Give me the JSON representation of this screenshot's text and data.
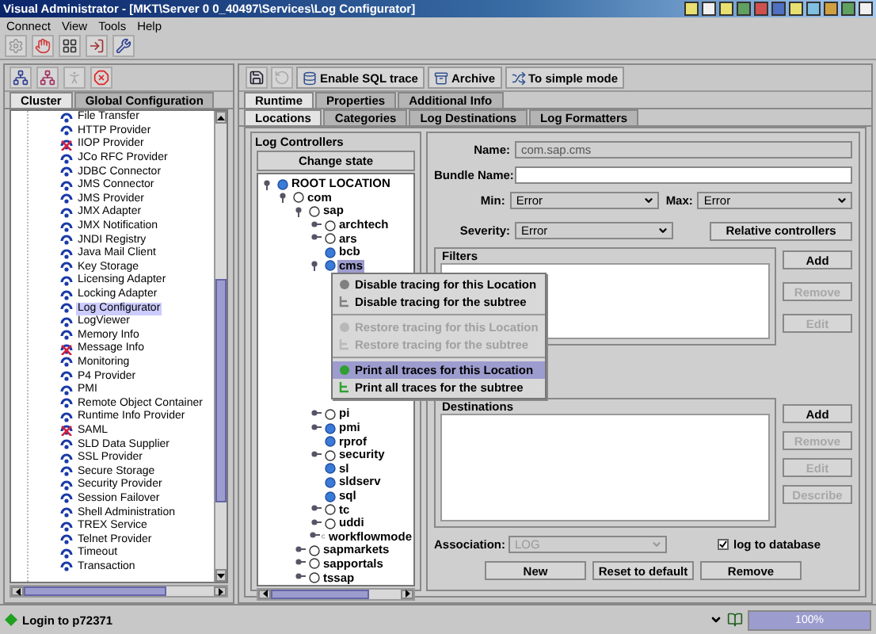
{
  "window": {
    "title": "Visual Administrator - [MKT\\Server 0 0_40497\\Services\\Log Configurator]"
  },
  "menu_bar": [
    "Connect",
    "View",
    "Tools",
    "Help"
  ],
  "sidebar": {
    "tabs": [
      {
        "label": "Cluster",
        "selected": true
      },
      {
        "label": "Global Configuration",
        "selected": false
      }
    ],
    "items": [
      {
        "label": "File Transfer",
        "stopped": false,
        "selected": false
      },
      {
        "label": "HTTP Provider",
        "stopped": false,
        "selected": false
      },
      {
        "label": "IIOP Provider",
        "stopped": true,
        "selected": false
      },
      {
        "label": "JCo RFC Provider",
        "stopped": false,
        "selected": false
      },
      {
        "label": "JDBC Connector",
        "stopped": false,
        "selected": false
      },
      {
        "label": "JMS Connector",
        "stopped": false,
        "selected": false
      },
      {
        "label": "JMS Provider",
        "stopped": false,
        "selected": false
      },
      {
        "label": "JMX Adapter",
        "stopped": false,
        "selected": false
      },
      {
        "label": "JMX Notification",
        "stopped": false,
        "selected": false
      },
      {
        "label": "JNDI Registry",
        "stopped": false,
        "selected": false
      },
      {
        "label": "Java Mail Client",
        "stopped": false,
        "selected": false
      },
      {
        "label": "Key Storage",
        "stopped": false,
        "selected": false
      },
      {
        "label": "Licensing Adapter",
        "stopped": false,
        "selected": false
      },
      {
        "label": "Locking Adapter",
        "stopped": false,
        "selected": false
      },
      {
        "label": "Log Configurator",
        "stopped": false,
        "selected": true
      },
      {
        "label": "LogViewer",
        "stopped": false,
        "selected": false
      },
      {
        "label": "Memory Info",
        "stopped": false,
        "selected": false
      },
      {
        "label": "Message Info",
        "stopped": true,
        "selected": false
      },
      {
        "label": "Monitoring",
        "stopped": false,
        "selected": false
      },
      {
        "label": "P4 Provider",
        "stopped": false,
        "selected": false
      },
      {
        "label": "PMI",
        "stopped": false,
        "selected": false
      },
      {
        "label": "Remote Object Container",
        "stopped": false,
        "selected": false
      },
      {
        "label": "Runtime Info Provider",
        "stopped": false,
        "selected": false
      },
      {
        "label": "SAML",
        "stopped": true,
        "selected": false
      },
      {
        "label": "SLD Data Supplier",
        "stopped": false,
        "selected": false
      },
      {
        "label": "SSL Provider",
        "stopped": false,
        "selected": false
      },
      {
        "label": "Secure Storage",
        "stopped": false,
        "selected": false
      },
      {
        "label": "Security Provider",
        "stopped": false,
        "selected": false
      },
      {
        "label": "Session Failover",
        "stopped": false,
        "selected": false
      },
      {
        "label": "Shell Administration",
        "stopped": false,
        "selected": false
      },
      {
        "label": "TREX Service",
        "stopped": false,
        "selected": false
      },
      {
        "label": "Telnet Provider",
        "stopped": false,
        "selected": false
      },
      {
        "label": "Timeout",
        "stopped": false,
        "selected": false
      },
      {
        "label": "Transaction",
        "stopped": false,
        "selected": false
      }
    ]
  },
  "toolbar": {
    "buttons": [
      {
        "label": "Enable SQL trace",
        "kind": "trace"
      },
      {
        "label": "Archive",
        "kind": "archive"
      },
      {
        "label": "To simple mode",
        "kind": "mode"
      }
    ]
  },
  "tabs": [
    {
      "label": "Runtime",
      "selected": true
    },
    {
      "label": "Properties",
      "selected": false
    },
    {
      "label": "Additional Info",
      "selected": false
    }
  ],
  "subtabs": [
    {
      "label": "Locations",
      "selected": true
    },
    {
      "label": "Categories",
      "selected": false
    },
    {
      "label": "Log Destinations",
      "selected": false
    },
    {
      "label": "Log Formatters",
      "selected": false
    }
  ],
  "log_controllers": {
    "title": "Log Controllers",
    "button": "Change state",
    "tree": [
      {
        "label": "ROOT LOCATION",
        "active": true,
        "expanded": true,
        "selected": false,
        "children": [
          {
            "label": "com",
            "active": false,
            "expanded": true,
            "selected": false,
            "children": [
              {
                "label": "sap",
                "active": false,
                "expanded": true,
                "selected": false,
                "children": [
                  {
                    "label": "archtech",
                    "active": false,
                    "expanded": false,
                    "selected": false
                  },
                  {
                    "label": "ars",
                    "active": false,
                    "expanded": false,
                    "selected": false
                  },
                  {
                    "label": "bcb",
                    "active": true,
                    "selected": false
                  },
                  {
                    "label": "cms",
                    "active": true,
                    "expanded": true,
                    "selected": true
                  },
                  {
                    "label": "pi",
                    "active": false,
                    "expanded": false,
                    "selected": false
                  },
                  {
                    "label": "pmi",
                    "active": true,
                    "expanded": false,
                    "selected": false
                  },
                  {
                    "label": "rprof",
                    "active": true,
                    "selected": false
                  },
                  {
                    "label": "security",
                    "active": false,
                    "expanded": false,
                    "selected": false
                  },
                  {
                    "label": "sl",
                    "active": true,
                    "selected": false
                  },
                  {
                    "label": "sldserv",
                    "active": true,
                    "selected": false
                  },
                  {
                    "label": "sql",
                    "active": true,
                    "selected": false
                  },
                  {
                    "label": "tc",
                    "active": false,
                    "expanded": false,
                    "selected": false
                  },
                  {
                    "label": "uddi",
                    "active": false,
                    "expanded": false,
                    "selected": false
                  },
                  {
                    "label": "workflowmode",
                    "active": false,
                    "expanded": false,
                    "selected": false
                  }
                ]
              },
              {
                "label": "sapmarkets",
                "active": false,
                "expanded": false,
                "selected": false
              },
              {
                "label": "sapportals",
                "active": false,
                "expanded": false,
                "selected": false
              },
              {
                "label": "tssap",
                "active": false,
                "expanded": false,
                "selected": false
              }
            ]
          }
        ]
      }
    ]
  },
  "context_menu": [
    {
      "kind": "location",
      "color": "#808080",
      "label": "Disable tracing for this Location",
      "disabled": false,
      "selected": false
    },
    {
      "kind": "subtree",
      "color": "#808080",
      "label": "Disable tracing for the subtree",
      "disabled": false,
      "selected": false
    },
    {
      "kind": "separator"
    },
    {
      "kind": "location",
      "color": "#b8b8b8",
      "label": "Restore tracing for this Location",
      "disabled": true,
      "selected": false
    },
    {
      "kind": "subtree",
      "color": "#b8b8b8",
      "label": "Restore tracing for the subtree",
      "disabled": true,
      "selected": false
    },
    {
      "kind": "separator"
    },
    {
      "kind": "location",
      "color": "#30a030",
      "label": "Print all traces for this Location",
      "disabled": false,
      "selected": true
    },
    {
      "kind": "subtree",
      "color": "#30a030",
      "label": "Print all traces for the subtree",
      "disabled": false,
      "selected": false
    }
  ],
  "form": {
    "name_label": "Name:",
    "name": "com.sap.cms",
    "bundle_label": "Bundle Name:",
    "min_label": "Min:",
    "min": "Error",
    "max_label": "Max:",
    "max": "Error",
    "severity_label": "Severity:",
    "severity": "Error",
    "relative_button": "Relative controllers",
    "filters": {
      "title": "Filters",
      "buttons": [
        {
          "label": "Add",
          "disabled": false
        },
        {
          "label": "Remove",
          "disabled": true
        },
        {
          "label": "Edit",
          "disabled": true
        }
      ]
    },
    "destinations": {
      "title": "Destinations",
      "buttons": [
        {
          "label": "Add",
          "disabled": false
        },
        {
          "label": "Remove",
          "disabled": true
        },
        {
          "label": "Edit",
          "disabled": true
        },
        {
          "label": "Describe",
          "disabled": true
        }
      ]
    },
    "association_label": "Association:",
    "association": "LOG",
    "association_disabled": true,
    "log_to_database": {
      "label": "log to database",
      "checked": true
    },
    "buttons": [
      "New",
      "Reset to default",
      "Remove"
    ]
  },
  "status_bar": {
    "text": "Login to p72371",
    "progress": "100%",
    "level": 1
  }
}
